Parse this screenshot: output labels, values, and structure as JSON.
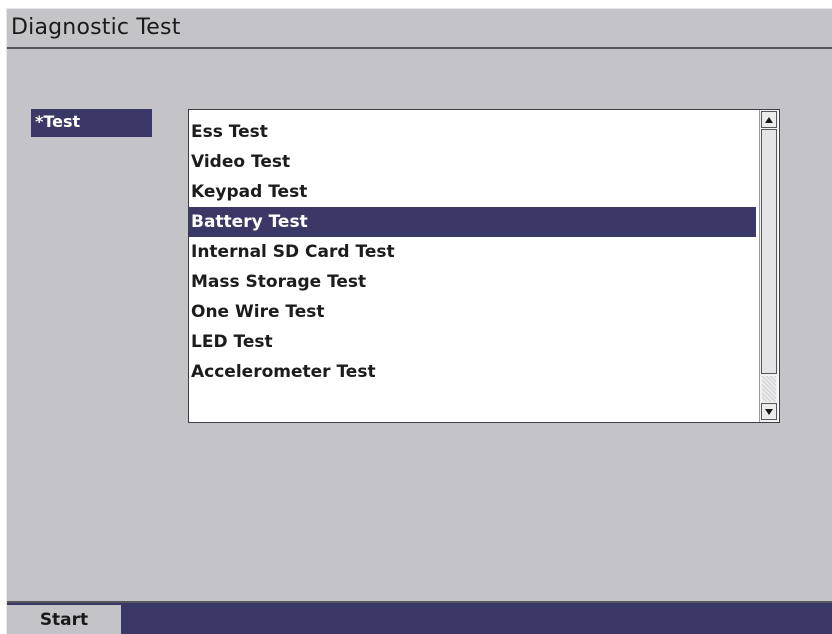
{
  "window": {
    "title": "Diagnostic Test"
  },
  "field": {
    "label": "*Test"
  },
  "test_list": {
    "items": [
      {
        "label": "Ess Test"
      },
      {
        "label": "Video Test"
      },
      {
        "label": "Keypad Test"
      },
      {
        "label": "Battery Test",
        "selected": true
      },
      {
        "label": "Internal SD Card Test"
      },
      {
        "label": "Mass Storage Test"
      },
      {
        "label": "One Wire Test"
      },
      {
        "label": "LED Test"
      },
      {
        "label": "Accelerometer Test"
      }
    ],
    "selected_value": "Battery Test"
  },
  "softkeys": {
    "start_label": "Start"
  },
  "colors": {
    "background": "#c4c4c8",
    "accent": "#3a3866",
    "list_background": "#ffffff"
  },
  "icons": {
    "scroll_up": "arrow-up-icon",
    "scroll_down": "arrow-down-icon"
  }
}
